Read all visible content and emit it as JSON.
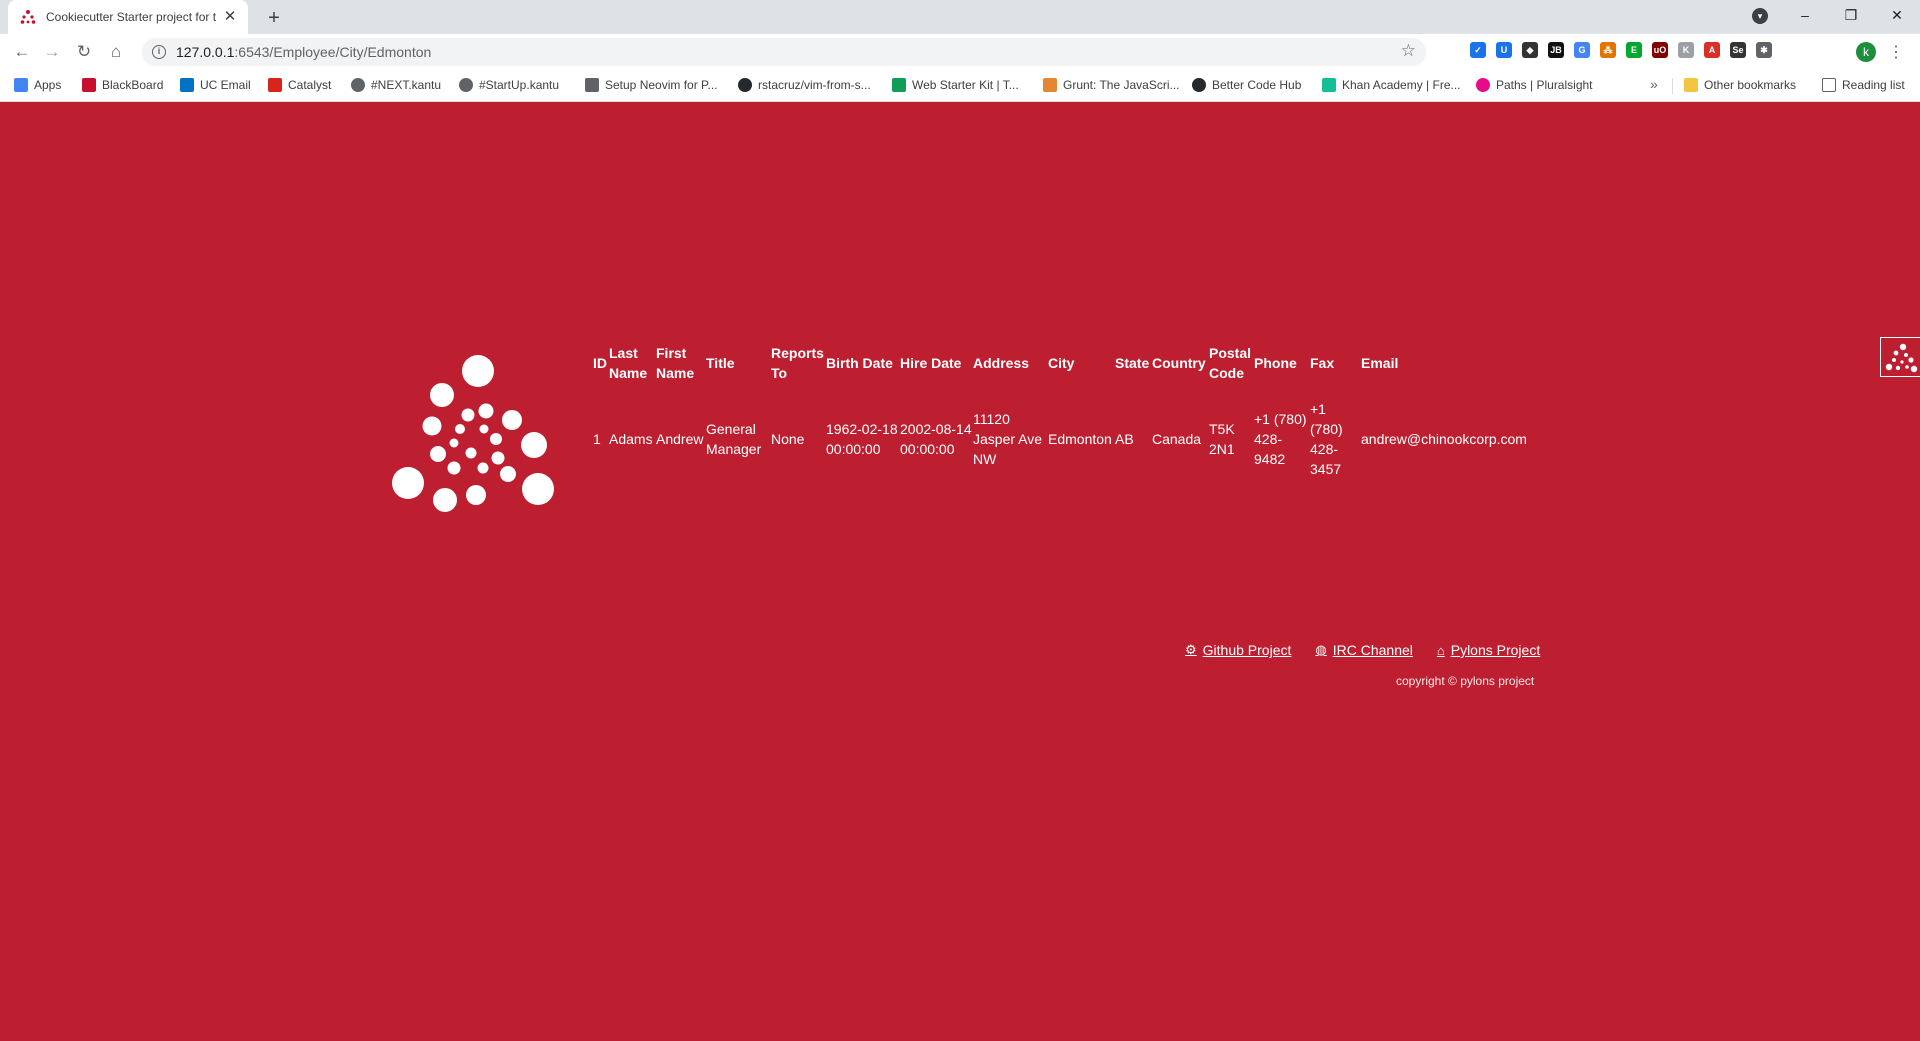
{
  "browser": {
    "tab_title": "Cookiecutter Starter project for the Pyramid Web Framework",
    "tab_close": "✕",
    "new_tab": "+",
    "window_controls": [
      "–",
      "❐",
      "✕"
    ],
    "url_host": "127.0.0.1",
    "url_path": ":6543/Employee/City/Edmonton",
    "avatar_letter": "k",
    "bookmarks": [
      {
        "label": "Apps",
        "color": "#4285f4"
      },
      {
        "label": "BlackBoard",
        "color": "#c8102e"
      },
      {
        "label": "UC Email",
        "color": "#0072c6"
      },
      {
        "label": "Catalyst",
        "color": "#d9241b"
      },
      {
        "label": "#NEXT.kantu",
        "color": "#5f6368"
      },
      {
        "label": "#StartUp.kantu",
        "color": "#5f6368"
      },
      {
        "label": "Setup Neovim for P...",
        "color": "#5f6368"
      },
      {
        "label": "rstacruz/vim-from-s...",
        "color": "#24292e"
      },
      {
        "label": "Web Starter Kit | T...",
        "color": "#0f9d58"
      },
      {
        "label": "Grunt: The JavaScri...",
        "color": "#e48632"
      },
      {
        "label": "Better Code Hub",
        "color": "#24292e"
      },
      {
        "label": "Khan Academy | Fre...",
        "color": "#14bf96"
      },
      {
        "label": "Paths | Pluralsight",
        "color": "#e80a89"
      }
    ],
    "bookmarks_more": "»",
    "other_bookmarks": "Other bookmarks",
    "reading_list": "Reading list"
  },
  "table": {
    "headers": [
      "ID",
      "Last Name",
      "First Name",
      "Title",
      "Reports To",
      "Birth Date",
      "Hire Date",
      "Address",
      "City",
      "State",
      "Country",
      "Postal Code",
      "Phone",
      "Fax",
      "Email"
    ],
    "rows": [
      [
        "1",
        "Adams",
        "Andrew",
        "General Manager",
        "None",
        "1962-02-18 00:00:00",
        "2002-08-14 00:00:00",
        "11120 Jasper Ave NW",
        "Edmonton",
        "AB",
        "Canada",
        "T5K 2N1",
        "+1 (780) 428-9482",
        "+1 (780) 428-3457",
        "andrew@chinookcorp.com"
      ]
    ]
  },
  "footer": {
    "links": [
      {
        "label": "Github Project",
        "icon": "gear-icon"
      },
      {
        "label": "IRC Channel",
        "icon": "globe-icon"
      },
      {
        "label": "Pylons Project",
        "icon": "home-icon"
      }
    ],
    "copyright": "copyright © pylons project"
  },
  "colors": {
    "page_background": "#bd1f31",
    "text": "#ffffff"
  }
}
